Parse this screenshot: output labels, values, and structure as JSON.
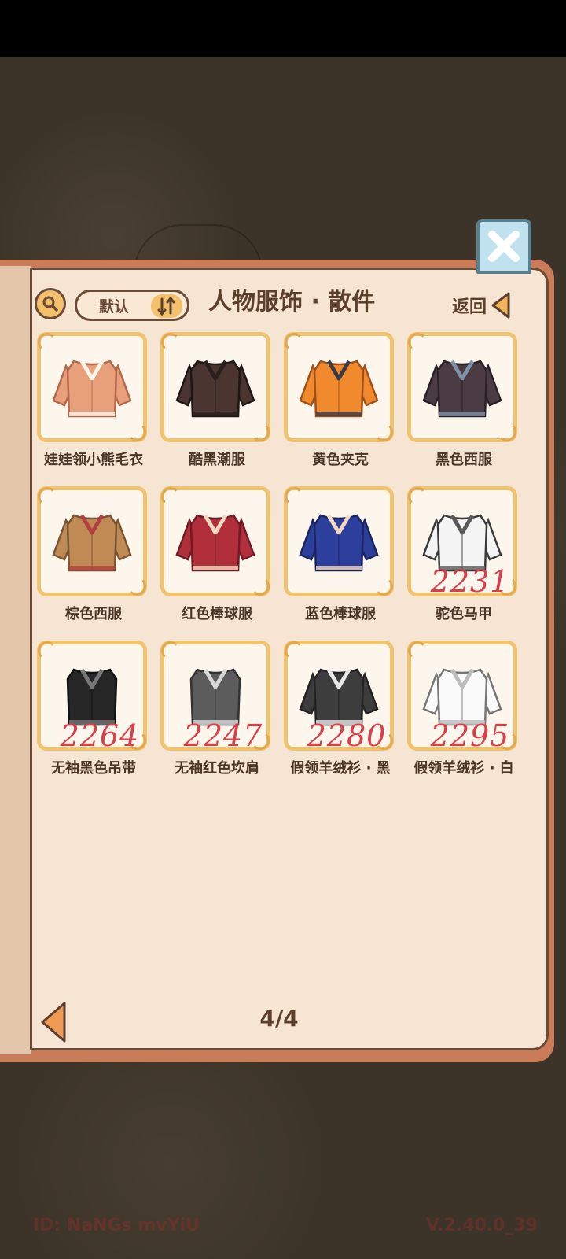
{
  "header": {
    "title": "人物服饰 · 散件",
    "sort_label": "默认",
    "back_label": "返回"
  },
  "items": [
    {
      "name": "娃娃领小熊毛衣",
      "icon": "bear-sweater-icon",
      "price": ""
    },
    {
      "name": "酷黑潮服",
      "icon": "black-gloves-outfit-icon",
      "price": ""
    },
    {
      "name": "黄色夹克",
      "icon": "yellow-jacket-icon",
      "price": ""
    },
    {
      "name": "黑色西服",
      "icon": "black-suit-icon",
      "price": ""
    },
    {
      "name": "棕色西服",
      "icon": "brown-suit-icon",
      "price": ""
    },
    {
      "name": "红色棒球服",
      "icon": "red-baseball-jacket-icon",
      "price": ""
    },
    {
      "name": "蓝色棒球服",
      "icon": "blue-baseball-jacket-icon",
      "price": ""
    },
    {
      "name": "驼色马甲",
      "icon": "vest-icon",
      "price": "2231"
    },
    {
      "name": "无袖黑色吊带",
      "icon": "black-camisole-icon",
      "price": "2264"
    },
    {
      "name": "无袖红色坎肩",
      "icon": "sleeveless-vest-icon",
      "price": "2247"
    },
    {
      "name": "假领羊绒衫 · 黑",
      "icon": "black-sweater-icon",
      "price": "2280"
    },
    {
      "name": "假领羊绒衫 · 白",
      "icon": "white-sweater-icon",
      "price": "2295"
    }
  ],
  "pagination": {
    "current": "4/4"
  },
  "footer": {
    "id": "ID: NaNGs mvYiU",
    "version": "V.2.40.0_39"
  },
  "colors": {
    "frame": "#f2c36f",
    "page": "#f5e5d2",
    "price": "#d93f4a",
    "book_edge": "#c97c57"
  }
}
